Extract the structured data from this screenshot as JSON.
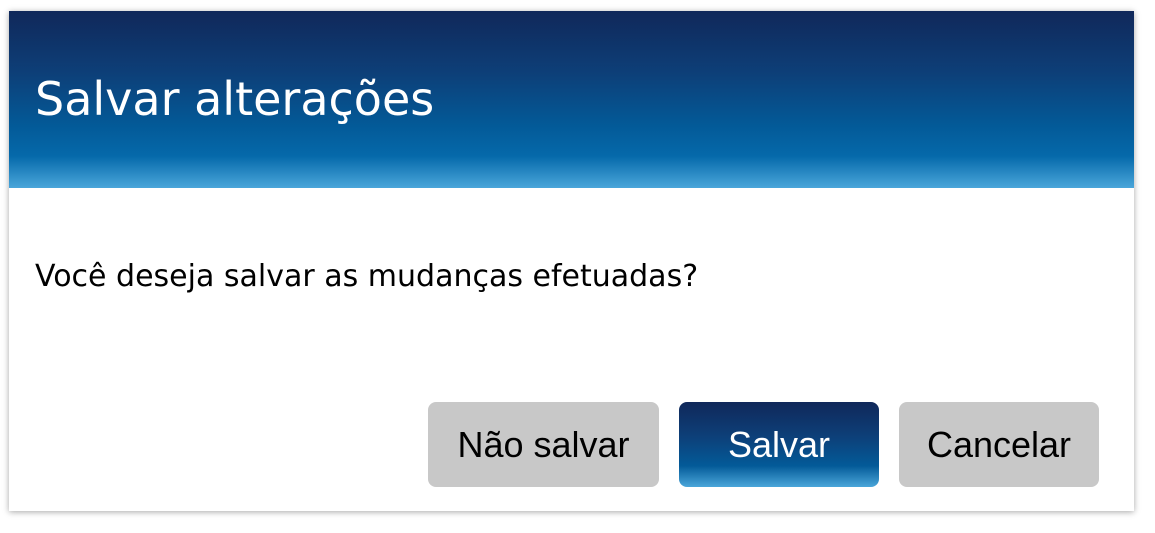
{
  "dialog": {
    "title": "Salvar alterações",
    "message": "Você deseja salvar as mudanças efetuadas?",
    "buttons": {
      "dont_save_label": "Não salvar",
      "save_label": "Salvar",
      "cancel_label": "Cancelar"
    }
  },
  "colors": {
    "header_top": "#10285a",
    "header_mid": "#035a98",
    "header_bottom": "#4aa6da",
    "secondary_button": "#c8c8c8"
  }
}
